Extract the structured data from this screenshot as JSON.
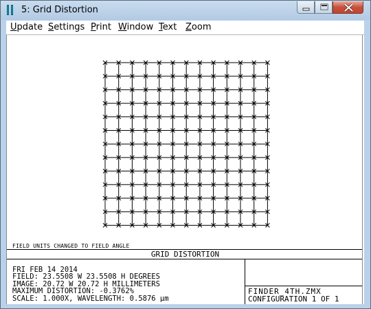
{
  "window": {
    "title": "5: Grid Distortion"
  },
  "menu": {
    "items": [
      {
        "label_prefix": "",
        "label_accel": "U",
        "label_rest": "pdate",
        "name": "menu-update"
      },
      {
        "label_prefix": "",
        "label_accel": "S",
        "label_rest": "ettings",
        "name": "menu-settings"
      },
      {
        "label_prefix": "",
        "label_accel": "P",
        "label_rest": "rint",
        "name": "menu-print"
      },
      {
        "label_prefix": "",
        "label_accel": "W",
        "label_rest": "indow",
        "name": "menu-window"
      },
      {
        "label_prefix": "",
        "label_accel": "T",
        "label_rest": "ext",
        "name": "menu-text"
      },
      {
        "label_prefix": "",
        "label_accel": "Z",
        "label_rest": "oom",
        "name": "menu-zoom"
      }
    ]
  },
  "plot": {
    "field_note": "FIELD UNITS CHANGED TO FIELD ANGLE",
    "grid_title": "GRID DISTORTION",
    "grid_size": 13,
    "info_lines": [
      "FRI FEB 14 2014",
      "FIELD: 23.5508 W 23.5508 H DEGREES",
      "IMAGE: 20.72 W 20.72 H MILLIMETERS",
      "MAXIMUM DISTORTION: -0.3762%",
      "SCALE: 1.000X, WAVELENGTH: 0.5876 µm"
    ],
    "file_name": "FINDER_4TH.ZMX",
    "configuration": "CONFIGURATION 1 OF 1"
  }
}
